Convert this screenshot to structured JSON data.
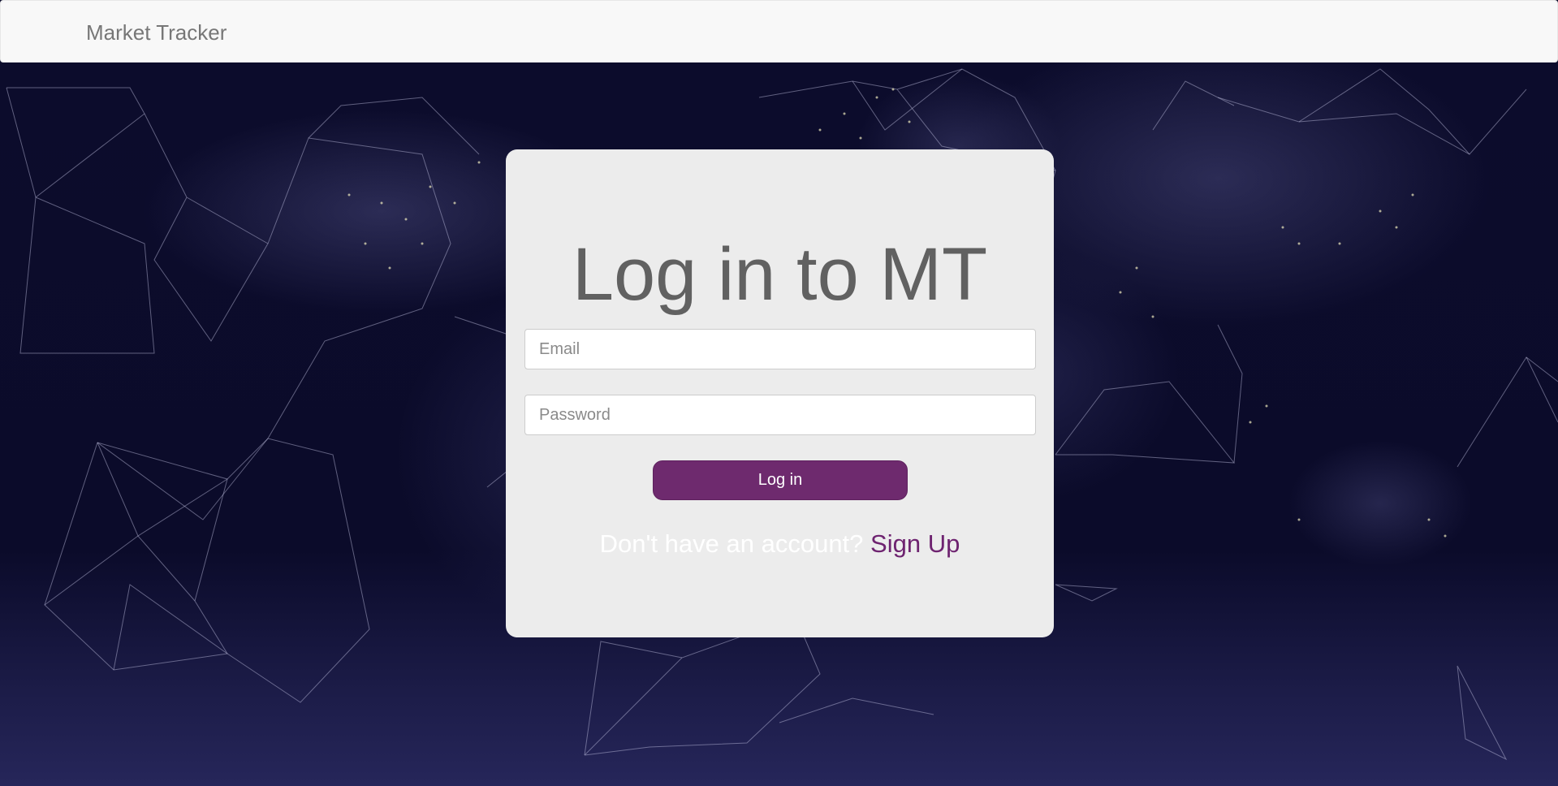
{
  "navbar": {
    "brand": "Market Tracker"
  },
  "login": {
    "title": "Log in to MT",
    "email_placeholder": "Email",
    "password_placeholder": "Password",
    "submit_label": "Log in",
    "signup_prompt": "Don't have an account?",
    "signup_link": "Sign Up"
  },
  "colors": {
    "accent": "#6e2a6e",
    "card": "#ececec",
    "navbar": "#f8f8f8",
    "background": "#0a0a2a"
  },
  "background": {
    "description_icon": "world-map-network"
  }
}
